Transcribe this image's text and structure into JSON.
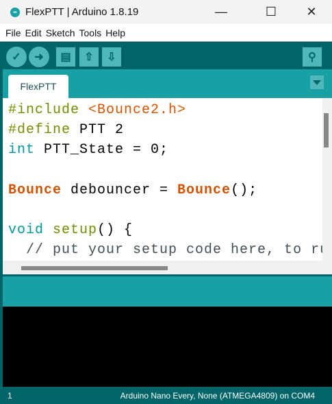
{
  "window": {
    "title": "FlexPTT | Arduino 1.8.19",
    "minimize": "—",
    "maximize": "☐",
    "close": "✕"
  },
  "menu": [
    "File",
    "Edit",
    "Sketch",
    "Tools",
    "Help"
  ],
  "toolbar": {
    "verify": "✓",
    "upload": "➜",
    "new": "▤",
    "open": "⇧",
    "save": "⇩",
    "serial_monitor": "⚲"
  },
  "tabs": [
    {
      "label": "FlexPTT"
    }
  ],
  "code": [
    [
      {
        "t": "#include",
        "c": "kw"
      },
      {
        "t": " "
      },
      {
        "t": "<Bounce2.h>",
        "c": "lib"
      }
    ],
    [
      {
        "t": "#define",
        "c": "kw"
      },
      {
        "t": " PTT 2"
      }
    ],
    [
      {
        "t": "int",
        "c": "ty"
      },
      {
        "t": " PTT_State = 0;"
      }
    ],
    [
      {
        "t": ""
      }
    ],
    [
      {
        "t": "Bounce",
        "c": "libb"
      },
      {
        "t": " debouncer = "
      },
      {
        "t": "Bounce",
        "c": "libb"
      },
      {
        "t": "();"
      }
    ],
    [
      {
        "t": ""
      }
    ],
    [
      {
        "t": "void",
        "c": "ty"
      },
      {
        "t": " "
      },
      {
        "t": "setup",
        "c": "kw"
      },
      {
        "t": "() {"
      }
    ],
    [
      {
        "t": "  // put your setup code here, to run once:",
        "c": "cm"
      }
    ]
  ],
  "status": {
    "line": "1",
    "board": "Arduino Nano Every, None (ATMEGA4809) on COM4"
  },
  "colors": {
    "toolbar": "#006468",
    "tabstrip": "#17a1a5",
    "keyword": "#728e00",
    "type": "#00979c",
    "library": "#d35400"
  }
}
